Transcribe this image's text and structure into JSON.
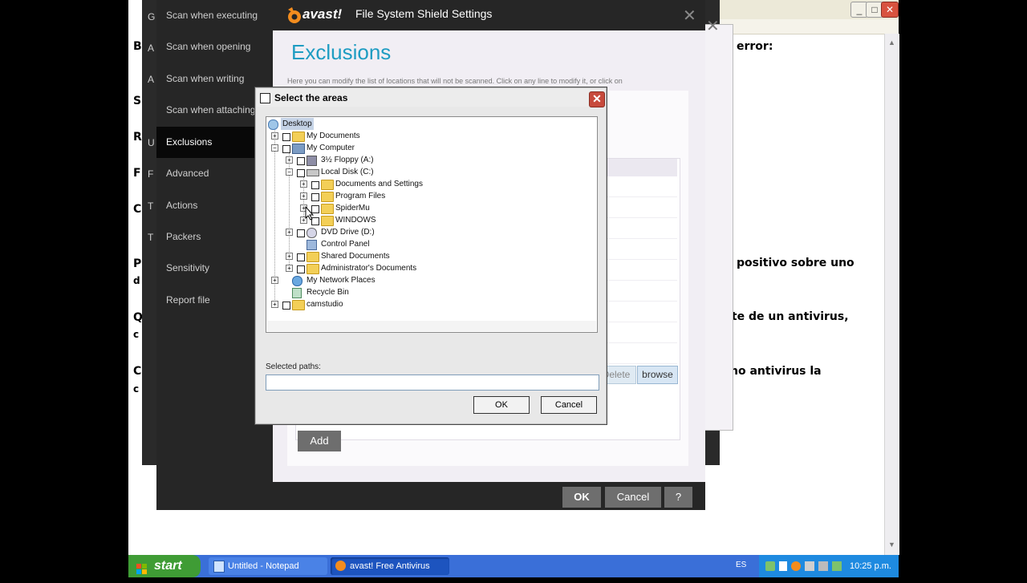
{
  "background_window": {
    "snippets": [
      "B",
      "S",
      "R",
      "F",
      "C",
      "P",
      "d",
      "Q",
      "c",
      "C",
      "c"
    ],
    "right_fragments": [
      "error:",
      "positivo sobre uno",
      "rte de un antivirus,",
      "ho antivirus la"
    ]
  },
  "avast": {
    "logo": "avast!",
    "title": "File System Shield Settings",
    "nav": [
      {
        "label": "Scan when executing"
      },
      {
        "label": "Scan when opening"
      },
      {
        "label": "Scan when writing"
      },
      {
        "label": "Scan when attaching"
      },
      {
        "label": "Exclusions"
      },
      {
        "label": "Advanced"
      },
      {
        "label": "Actions"
      },
      {
        "label": "Packers"
      },
      {
        "label": "Sensitivity"
      },
      {
        "label": "Report file"
      }
    ],
    "nav_letters": [
      "G",
      "A",
      "A",
      "U",
      "F",
      "T",
      "T"
    ],
    "heading": "Exclusions",
    "description": "Here you can modify the list of locations that will not be scanned. Click on any line to modify it, or click on",
    "delete_label": "Delete",
    "browse_label": "browse",
    "add_label": "Add",
    "ok_label": "OK",
    "cancel_label": "Cancel",
    "help_label": "?"
  },
  "dialog": {
    "title": "Select the areas",
    "tree": [
      {
        "label": "Desktop",
        "icon": "desktop-icon",
        "selected": true
      },
      {
        "label": "My Documents",
        "icon": "my-documents-icon"
      },
      {
        "label": "My Computer",
        "icon": "my-computer-icon"
      },
      {
        "label": "3½ Floppy (A:)",
        "icon": "floppy-icon"
      },
      {
        "label": "Local Disk (C:)",
        "icon": "hard-disk-icon"
      },
      {
        "label": "Documents and Settings",
        "icon": "folder-icon"
      },
      {
        "label": "Program Files",
        "icon": "folder-icon"
      },
      {
        "label": "SpiderMu",
        "icon": "folder-icon"
      },
      {
        "label": "WINDOWS",
        "icon": "folder-icon"
      },
      {
        "label": "DVD Drive (D:)",
        "icon": "dvd-drive-icon"
      },
      {
        "label": "Control Panel",
        "icon": "control-panel-icon"
      },
      {
        "label": "Shared Documents",
        "icon": "folder-icon"
      },
      {
        "label": "Administrator's Documents",
        "icon": "folder-icon"
      },
      {
        "label": "My Network Places",
        "icon": "network-places-icon"
      },
      {
        "label": "Recycle Bin",
        "icon": "recycle-bin-icon"
      },
      {
        "label": "camstudio",
        "icon": "folder-icon"
      }
    ],
    "selected_paths_label": "Selected paths:",
    "selected_paths_value": "",
    "ok_label": "OK",
    "cancel_label": "Cancel"
  },
  "taskbar": {
    "start_label": "start",
    "tasks": [
      {
        "label": "Untitled - Notepad"
      },
      {
        "label": "avast! Free Antivirus"
      }
    ],
    "language": "ES",
    "time": "10:25 p.m."
  },
  "colors": {
    "accent": "#1e9cc2",
    "avast_orange": "#f28c1e",
    "dark_panel": "#262626",
    "xp_blue": "#3a6fd8",
    "xp_green": "#3f9c35"
  }
}
